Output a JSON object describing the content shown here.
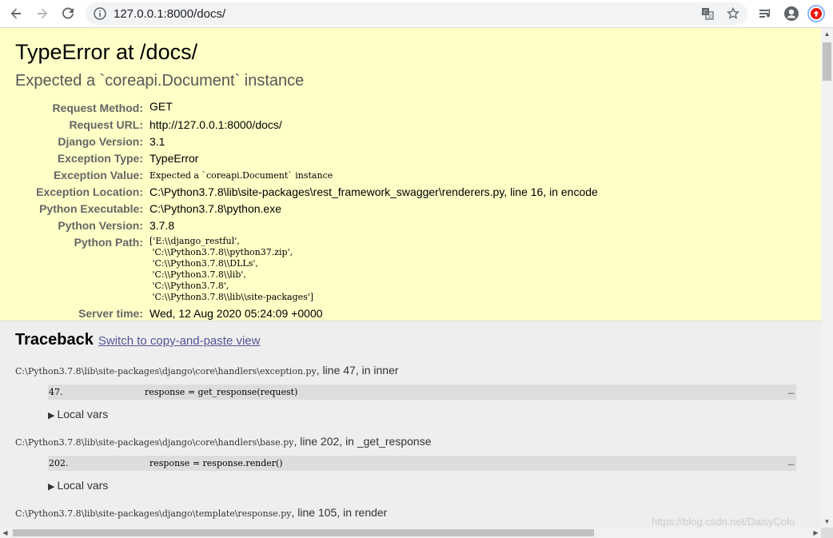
{
  "browser": {
    "url_host": "127.0.0.1:8000",
    "url_path": "/docs/",
    "icons": [
      "back-icon",
      "forward-icon",
      "reload-icon",
      "info-icon",
      "translate-icon",
      "star-icon",
      "reading-list-icon",
      "profile-icon",
      "extension-icon"
    ]
  },
  "error": {
    "title": "TypeError at /docs/",
    "subtitle": "Expected a `coreapi.Document` instance",
    "meta": [
      {
        "label": "Request Method:",
        "value": "GET"
      },
      {
        "label": "Request URL:",
        "value": "http://127.0.0.1:8000/docs/"
      },
      {
        "label": "Django Version:",
        "value": "3.1"
      },
      {
        "label": "Exception Type:",
        "value": "TypeError"
      },
      {
        "label": "Exception Value:",
        "value": "Expected a `coreapi.Document` instance"
      },
      {
        "label": "Exception Location:",
        "value": "C:\\Python3.7.8\\lib\\site-packages\\rest_framework_swagger\\renderers.py, line 16, in encode"
      },
      {
        "label": "Python Executable:",
        "value": "C:\\Python3.7.8\\python.exe"
      },
      {
        "label": "Python Version:",
        "value": "3.7.8"
      },
      {
        "label": "Python Path:",
        "value": "['E:\\\\django_restful',\n 'C:\\\\Python3.7.8\\\\python37.zip',\n 'C:\\\\Python3.7.8\\\\DLLs',\n 'C:\\\\Python3.7.8\\\\lib',\n 'C:\\\\Python3.7.8',\n 'C:\\\\Python3.7.8\\\\lib\\\\site-packages']"
      },
      {
        "label": "Server time:",
        "value": "Wed, 12 Aug 2020 05:24:09 +0000"
      }
    ]
  },
  "traceback": {
    "heading": "Traceback",
    "switch_link": "Switch to copy-and-paste view",
    "frames": [
      {
        "file": "C:\\Python3.7.8\\lib\\site-packages\\django\\core\\handlers\\exception.py",
        "location": ", line 47, in inner",
        "line_no": "47.",
        "code": "response = get_response(request)",
        "more": "...",
        "local_vars": "Local vars"
      },
      {
        "file": "C:\\Python3.7.8\\lib\\site-packages\\django\\core\\handlers\\base.py",
        "location": ", line 202, in _get_response",
        "line_no": "202.",
        "code": "response = response.render()",
        "more": "...",
        "local_vars": "Local vars"
      },
      {
        "file": "C:\\Python3.7.8\\lib\\site-packages\\django\\template\\response.py",
        "location": ", line 105, in render"
      }
    ]
  },
  "watermark": "https://blog.csdn.net/DaisyColo",
  "colors": {
    "summary_bg": "#ffffc8",
    "traceback_bg": "#eeeeee",
    "code_bg": "#dddddd",
    "link": "#555599"
  }
}
